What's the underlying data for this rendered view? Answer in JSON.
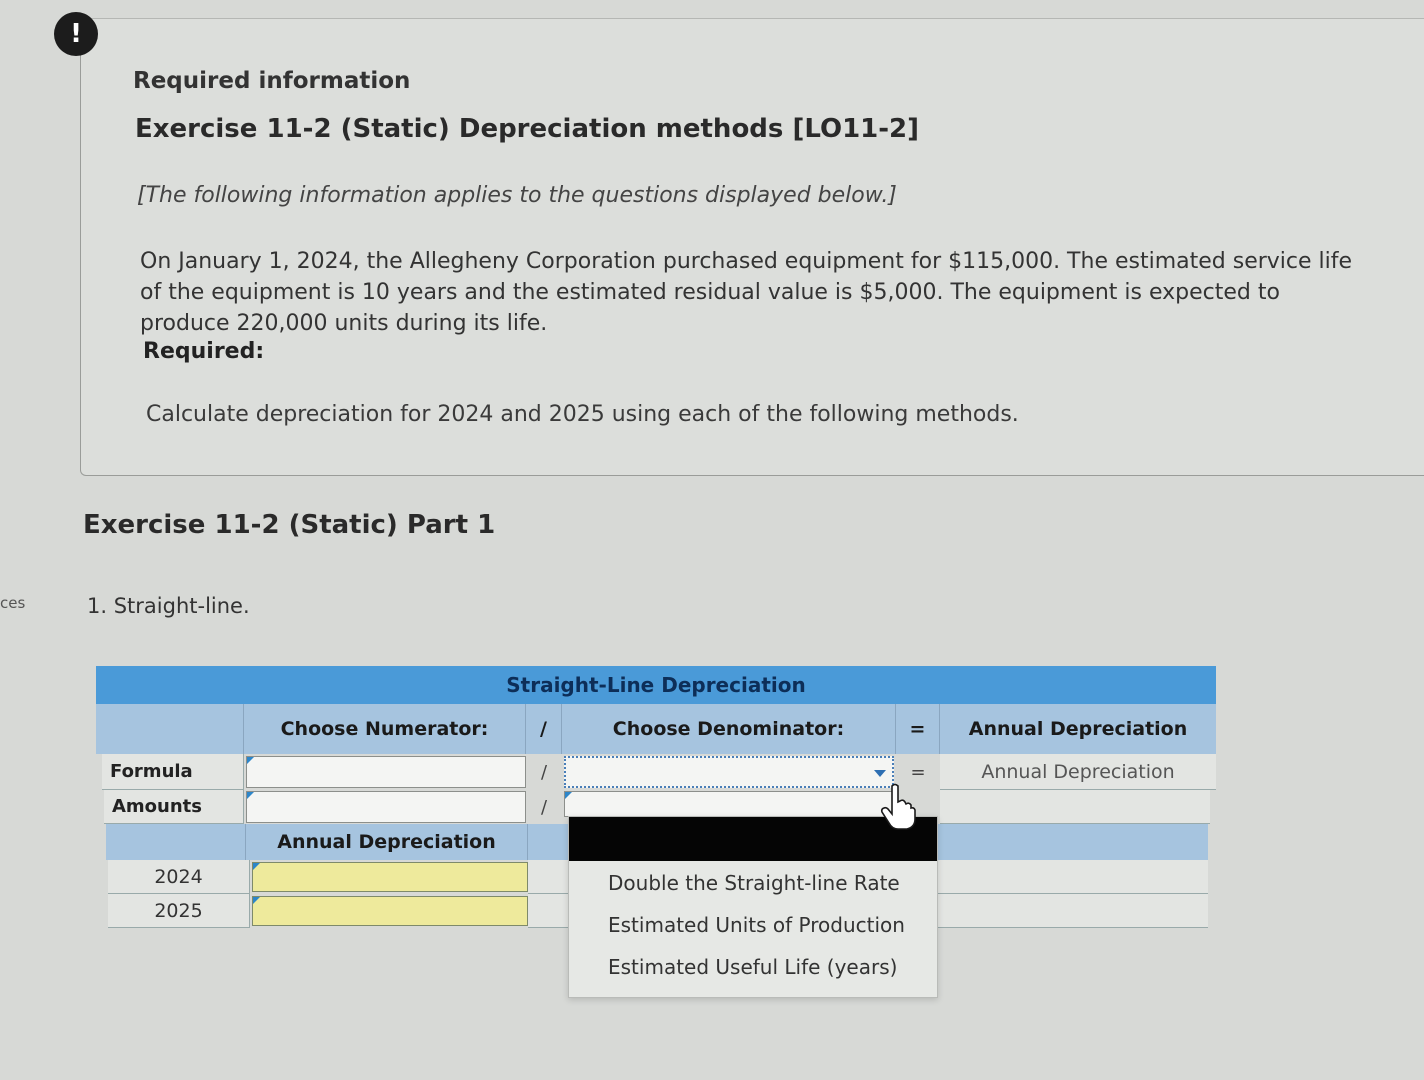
{
  "sidebar_fragment": "ces",
  "alert": {
    "symbol": "!"
  },
  "info": {
    "label": "Required information",
    "title": "Exercise 11-2 (Static) Depreciation methods [LO11-2]",
    "note": "[The following information applies to the questions displayed below.]",
    "paragraph": "On January 1, 2024, the Allegheny Corporation purchased equipment for $115,000. The estimated service life of the equipment is 10 years and the estimated residual value is $5,000. The equipment is expected to produce 220,000 units during its life.",
    "required": "Required:",
    "instruction": "Calculate depreciation for 2024 and 2025 using each of the following methods."
  },
  "part": {
    "title": "Exercise 11-2 (Static) Part 1",
    "question": "1. Straight-line."
  },
  "table": {
    "title": "Straight-Line Depreciation",
    "numerator_header": "Choose Numerator:",
    "divide_symbol": "/",
    "denominator_header": "Choose Denominator:",
    "equals_symbol": "=",
    "result_header": "Annual Depreciation",
    "rows": {
      "formula": "Formula",
      "amounts": "Amounts"
    },
    "formula_result": "Annual Depreciation",
    "annual_header": "Annual Depreciation",
    "years": [
      "2024",
      "2025"
    ]
  },
  "dropdown": {
    "options": [
      "Double the Straight-line Rate",
      "Estimated Units of Production",
      "Estimated Useful Life (years)"
    ]
  },
  "colors": {
    "header_blue": "#4a9ad8",
    "header_light": "#a6c4df",
    "input_yellow": "#eeea9c"
  }
}
